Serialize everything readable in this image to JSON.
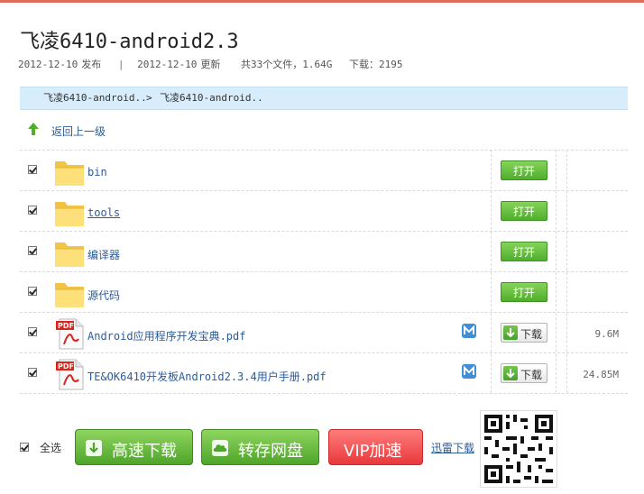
{
  "title": "飞凌6410-android2.3",
  "meta": {
    "published_date": "2012-12-10",
    "published_label": "发布",
    "separator": "|",
    "updated_date": "2012-12-10",
    "updated_label": "更新",
    "files_info": "共33个文件，1.64G",
    "downloads": "下载：2195"
  },
  "breadcrumb": {
    "item1": "飞凌6410-android..",
    "separator": ">",
    "item2": "飞凌6410-android.."
  },
  "up_level_label": "返回上一级",
  "files": [
    {
      "name": "bin",
      "type": "folder",
      "action": "打开",
      "size": ""
    },
    {
      "name": "tools",
      "type": "folder",
      "action": "打开",
      "size": ""
    },
    {
      "name": "编译器",
      "type": "folder",
      "action": "打开",
      "size": ""
    },
    {
      "name": "源代码",
      "type": "folder",
      "action": "打开",
      "size": ""
    },
    {
      "name": "Android应用程序开发宝典.pdf",
      "type": "pdf",
      "action": "下载",
      "size": "9.6M"
    },
    {
      "name": "TE&OK6410开发板Android2.3.4用户手册.pdf",
      "type": "pdf",
      "action": "下载",
      "size": "24.85M"
    }
  ],
  "bottom": {
    "select_all": "全选",
    "fast_download": "高速下载",
    "save_to_disk": "转存网盘",
    "vip_boost": "VIP加速",
    "xunlei_download": "迅雷下载"
  },
  "icons": {
    "up_arrow": "up-arrow-icon",
    "folder": "folder-icon",
    "pdf": "pdf-file-icon",
    "download": "download-arrow-icon",
    "cloud": "cloud-icon",
    "qr": "qr-code-icon"
  },
  "colors": {
    "accent_green": "#4fae2c",
    "vip_red": "#e8393c",
    "link_blue": "#2a5c9a",
    "breadcrumb_bg": "#d7edfb"
  }
}
